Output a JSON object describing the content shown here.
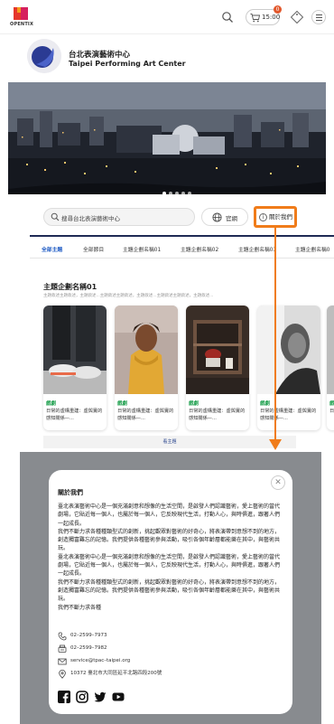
{
  "header": {
    "logo_text": "OPENTIX",
    "cart_time": "15:00",
    "cart_count": "0"
  },
  "venue": {
    "name_zh": "台北表演藝術中心",
    "name_en": "Taipei Performing Art Center"
  },
  "search": {
    "placeholder": "搜尋台北表演藝術中心",
    "website_label": "官網",
    "about_label": "關於我們"
  },
  "tabs": [
    "全部主題",
    "全部節目",
    "主題企劃名稱01",
    "主題企劃名稱02",
    "主題企劃名稱03",
    "主題企劃名稱0"
  ],
  "topic": {
    "title": "主題企劃名稱01",
    "subtitle": "主題敘述主題敘述，主題敘述...主題敘述主題敘述，主題敘述...主題敘述主題敘述，主題敘述...",
    "more_label": "看主題",
    "cards": [
      {
        "category": "戲劇",
        "desc": "日常的虛構重建：虛與實的感知關係—..."
      },
      {
        "category": "戲劇",
        "desc": "日常的虛構重建：虛與實的感知關係—..."
      },
      {
        "category": "戲劇",
        "desc": "日常的虛構重建：虛與實的感知關係—..."
      },
      {
        "category": "戲劇",
        "desc": "日常的虛構重建：虛與實的感知關係—..."
      },
      {
        "category": "戲",
        "desc": "日"
      }
    ]
  },
  "modal": {
    "title": "關於我們",
    "body": "臺北表演藝術中心是一個充滿創意和想像的生活空間，是啟發人們認識藝術，愛上藝術的當代劇場，它貼近每一個人，也屬於每一個人，它反映現代生活，打動人心，與時俱進，跟著人們一起成長。\n我們不斷力求各種種類型式的創新，挑起觀眾對藝術的好奇心，將表演帶到意想不到的地方，創造獨富難忘的記憶。我們提供各種藝術參與活動，吸引各個年齡層都能樂在其中，與藝術共玩。\n臺北表演藝術中心是一個充滿創意和想像的生活空間，是啟發人們認識藝術，愛上藝術的當代劇場，它貼近每一個人，也屬於每一個人，它反映現代生活，打動人心，與時俱進，跟著人們一起成長。\n我們不斷力求各種種類型式的創新，挑起觀眾對藝術的好奇心，將表演帶到意想不到的地方，創造獨富難忘的記憶。我們提供各種藝術參與活動，吸引各個年齡層都能樂在其中，與藝術共玩。\n我們不斷力求各種",
    "phone": "02–2599–7973",
    "fax": "02–2599–7982",
    "email": "service@tpac–taipei.org",
    "address": "10372 臺北市大同區延平北路四段200號"
  },
  "colors": {
    "accent_orange": "#f07c1a",
    "tab_active": "#1f5bc4",
    "category_green": "#1a9e4b"
  }
}
